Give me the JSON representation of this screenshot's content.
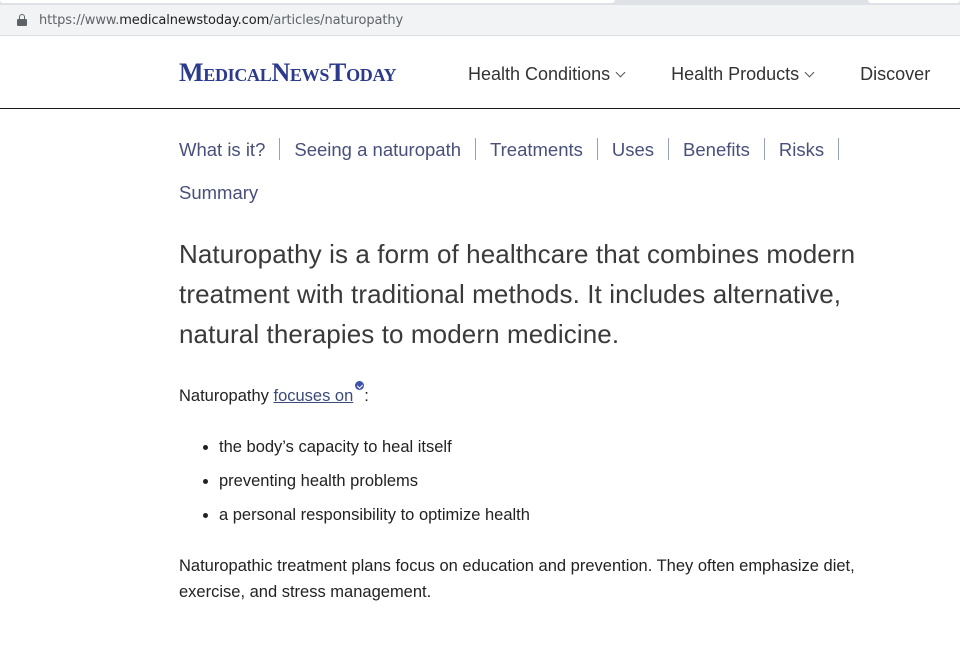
{
  "browser": {
    "url_prefix": "https://www.",
    "url_domain": "medicalnewstoday.com",
    "url_path": "/articles/naturopathy"
  },
  "site": {
    "logo": "MedicalNewsToday",
    "nav": [
      {
        "label": "Health Conditions"
      },
      {
        "label": "Health Products"
      },
      {
        "label": "Discover"
      }
    ]
  },
  "toc": {
    "items": [
      "What is it?",
      "Seeing a naturopath",
      "Treatments",
      "Uses",
      "Benefits",
      "Risks",
      "Summary"
    ]
  },
  "article": {
    "lede": "Naturopathy is a form of healthcare that combines modern treatment with traditional methods. It includes alternative, natural therapies to modern medicine.",
    "focus_intro": "Naturopathy ",
    "focus_link": "focuses on",
    "focus_suffix": ":",
    "bullets": [
      "the body’s capacity to heal itself",
      "preventing health problems",
      "a personal responsibility to optimize health"
    ],
    "closing": "Naturopathic treatment plans focus on education and prevention. They often emphasize diet, exercise, and stress management."
  },
  "colors": {
    "logo": "#2b3a8c",
    "toc_link": "#48507b",
    "badge": "#3f53a8"
  }
}
